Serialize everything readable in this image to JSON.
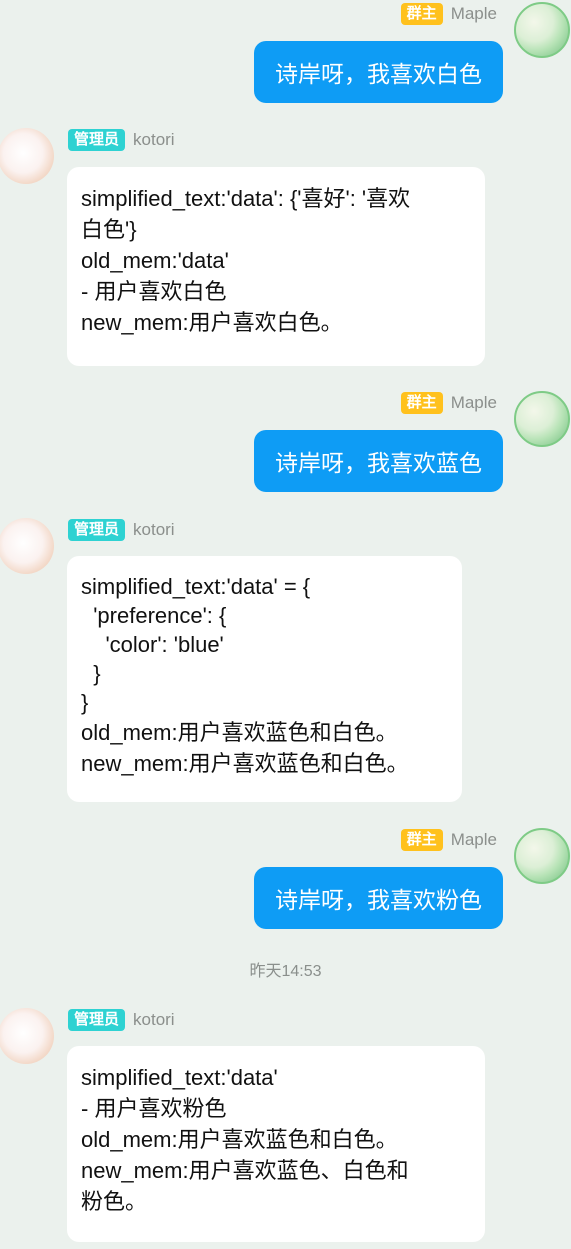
{
  "users": {
    "owner": {
      "badge": "群主",
      "name": "Maple"
    },
    "admin": {
      "badge": "管理员",
      "name": "kotori"
    }
  },
  "messages": [
    {
      "text": "诗岸呀，我喜欢白色"
    },
    {
      "lines": [
        "simplified_text:'data': {'喜好': '喜欢",
        "白色'}",
        "old_mem:'data'",
        "- 用户喜欢白色",
        "new_mem:用户喜欢白色。"
      ]
    },
    {
      "text": "诗岸呀，我喜欢蓝色"
    },
    {
      "lines": [
        "simplified_text:'data' = {",
        "  'preference': {",
        "    'color': 'blue'",
        "  }",
        "}",
        "old_mem:用户喜欢蓝色和白色。",
        "new_mem:用户喜欢蓝色和白色。"
      ]
    },
    {
      "text": "诗岸呀，我喜欢粉色"
    },
    {
      "lines": [
        "simplified_text:'data'",
        "- 用户喜欢粉色",
        "old_mem:用户喜欢蓝色和白色。",
        "new_mem:用户喜欢蓝色、白色和",
        "粉色。"
      ]
    }
  ],
  "timestamp": "昨天14:53",
  "colors": {
    "background": "#ebf1ed",
    "outgoing_bubble": "#0e9cf5",
    "owner_badge": "#ffc11d",
    "admin_badge": "#2ed2d2"
  }
}
